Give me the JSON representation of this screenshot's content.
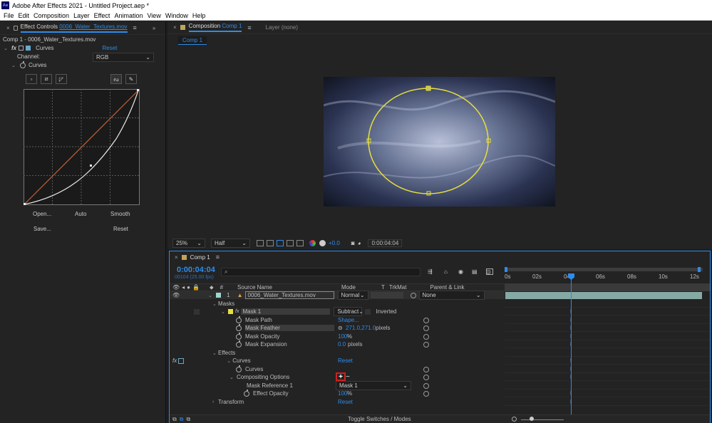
{
  "app": {
    "logo": "Ae",
    "title": "Adobe After Effects 2021 - Untitled Project.aep *",
    "menu": [
      "File",
      "Edit",
      "Composition",
      "Layer",
      "Effect",
      "Animation",
      "View",
      "Window",
      "Help"
    ]
  },
  "effect_controls": {
    "tab_label": "Effect Controls",
    "tab_file": "0006_Water_Textures.mov",
    "breadcrumb": "Comp 1 - 0006_Water_Textures.mov",
    "effect_name": "Curves",
    "reset": "Reset",
    "channel_label": "Channel:",
    "channel_value": "RGB",
    "curves_label": "Curves",
    "buttons": {
      "open": "Open...",
      "auto": "Auto",
      "smooth": "Smooth",
      "save": "Save...",
      "reset": "Reset"
    }
  },
  "composition": {
    "tab_prefix": "Composition",
    "comp_name": "Comp 1",
    "layer_tab": "Layer (none)",
    "sub_tab": "Comp 1",
    "zoom": "25%",
    "resolution": "Half",
    "exposure": "+0.0",
    "timecode": "0:00:04:04"
  },
  "timeline": {
    "tab": "Comp 1",
    "timecode": "0:00:04:04",
    "frame_info": "00104 (25.00 fps)",
    "search_placeholder": "",
    "columns": {
      "hash": "#",
      "source": "Source Name",
      "mode": "Mode",
      "t": "T",
      "trkmat": "TrkMat",
      "parent": "Parent & Link"
    },
    "layer": {
      "index": "1",
      "name": "0006_Water_Textures.mov",
      "mode": "Normal",
      "parent": "None"
    },
    "rows": {
      "masks": "Masks",
      "mask1": "Mask 1",
      "mask_mode": "Subtract",
      "inverted": "Inverted",
      "mask_path": "Mask Path",
      "mask_path_val": "Shape...",
      "mask_feather": "Mask Feather",
      "mask_feather_val": "271.0,271.0",
      "mask_feather_unit": "pixels",
      "mask_opacity": "Mask Opacity",
      "mask_opacity_val": "100",
      "pct": "%",
      "mask_expansion": "Mask Expansion",
      "mask_expansion_val": "0.0",
      "pixels": "pixels",
      "effects": "Effects",
      "curves": "Curves",
      "curves_reset": "Reset",
      "curves_prop": "Curves",
      "compositing": "Compositing Options",
      "plus": "+",
      "minus": "−",
      "mask_ref": "Mask Reference 1",
      "mask_ref_val": "Mask 1",
      "effect_opacity": "Effect Opacity",
      "effect_opacity_val": "100",
      "transform": "Transform",
      "transform_reset": "Reset"
    },
    "toggle": "Toggle Switches / Modes",
    "ruler": [
      "0s",
      "02s",
      "04s",
      "06s",
      "08s",
      "10s",
      "12s"
    ]
  }
}
